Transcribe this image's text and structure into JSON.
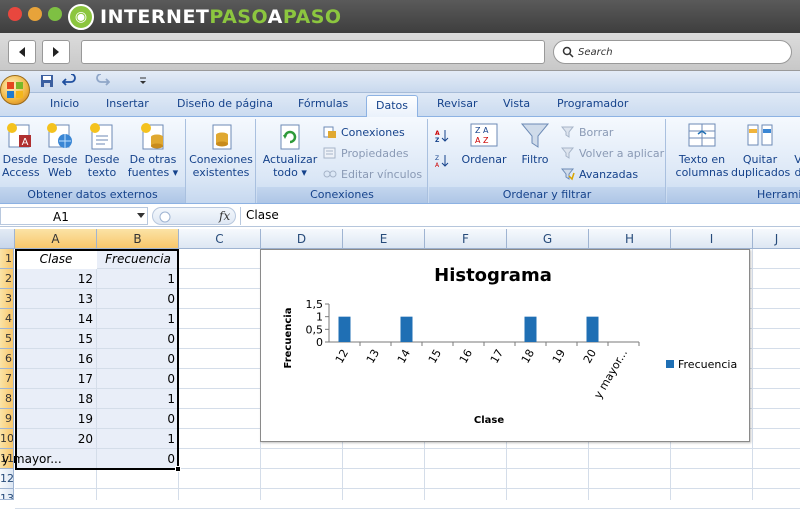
{
  "browser": {
    "logo_text_a": "INTERNET",
    "logo_text_b": "PASO",
    "logo_text_c": "A",
    "logo_text_d": "PASO",
    "search_placeholder": "Search"
  },
  "ribbon": {
    "tabs": [
      "Inicio",
      "Insertar",
      "Diseño de página",
      "Fórmulas",
      "Datos",
      "Revisar",
      "Vista",
      "Programador"
    ],
    "active_tab": "Datos",
    "groups": {
      "obtener": {
        "label": "Obtener datos externos",
        "desde_access": [
          "Desde",
          "Access"
        ],
        "desde_web": [
          "Desde",
          "Web"
        ],
        "desde_texto": [
          "Desde",
          "texto"
        ],
        "otras_fuentes": [
          "De otras",
          "fuentes ▾"
        ]
      },
      "conexiones_existentes": [
        "Conexiones",
        "existentes"
      ],
      "conexiones": {
        "label": "Conexiones",
        "actualizar": [
          "Actualizar",
          "todo ▾"
        ],
        "conexiones": "Conexiones",
        "propiedades": "Propiedades",
        "editar": "Editar vínculos"
      },
      "ordenar": {
        "label": "Ordenar y filtrar",
        "ordenar": "Ordenar",
        "filtro": "Filtro",
        "borrar": "Borrar",
        "volver": "Volver a aplicar",
        "avanzadas": "Avanzadas"
      },
      "herramientas": {
        "label": "Herrami",
        "texto_columnas": [
          "Texto en",
          "columnas"
        ],
        "quitar": [
          "Quitar",
          "duplicados"
        ],
        "v": [
          "V",
          "d"
        ]
      }
    }
  },
  "formula_bar": {
    "name_box": "A1",
    "fx": "fx",
    "content": "Clase"
  },
  "sheet": {
    "columns": [
      "A",
      "B",
      "C",
      "D",
      "E",
      "F",
      "G",
      "H",
      "I",
      "J"
    ],
    "rows": [
      "1",
      "2",
      "3",
      "4",
      "5",
      "6",
      "7",
      "8",
      "9",
      "10",
      "11",
      "12",
      "13"
    ],
    "headers": [
      "Clase",
      "Frecuencia"
    ],
    "data": [
      [
        "12",
        "1"
      ],
      [
        "13",
        "0"
      ],
      [
        "14",
        "1"
      ],
      [
        "15",
        "0"
      ],
      [
        "16",
        "0"
      ],
      [
        "17",
        "0"
      ],
      [
        "18",
        "1"
      ],
      [
        "19",
        "0"
      ],
      [
        "20",
        "1"
      ],
      [
        "y mayor...",
        "0"
      ]
    ]
  },
  "chart_data": {
    "type": "bar",
    "title": "Histograma",
    "xlabel": "Clase",
    "ylabel": "Frecuencia",
    "categories": [
      "12",
      "13",
      "14",
      "15",
      "16",
      "17",
      "18",
      "19",
      "20",
      "y mayor..."
    ],
    "series": [
      {
        "name": "Frecuencia",
        "values": [
          1,
          0,
          1,
          0,
          0,
          0,
          1,
          0,
          1,
          0
        ],
        "color": "#1f6fb4"
      }
    ],
    "yticks": [
      "0",
      "0,5",
      "1",
      "1,5"
    ],
    "ylim": [
      0,
      1.5
    ],
    "legend": "right",
    "grid": false
  }
}
